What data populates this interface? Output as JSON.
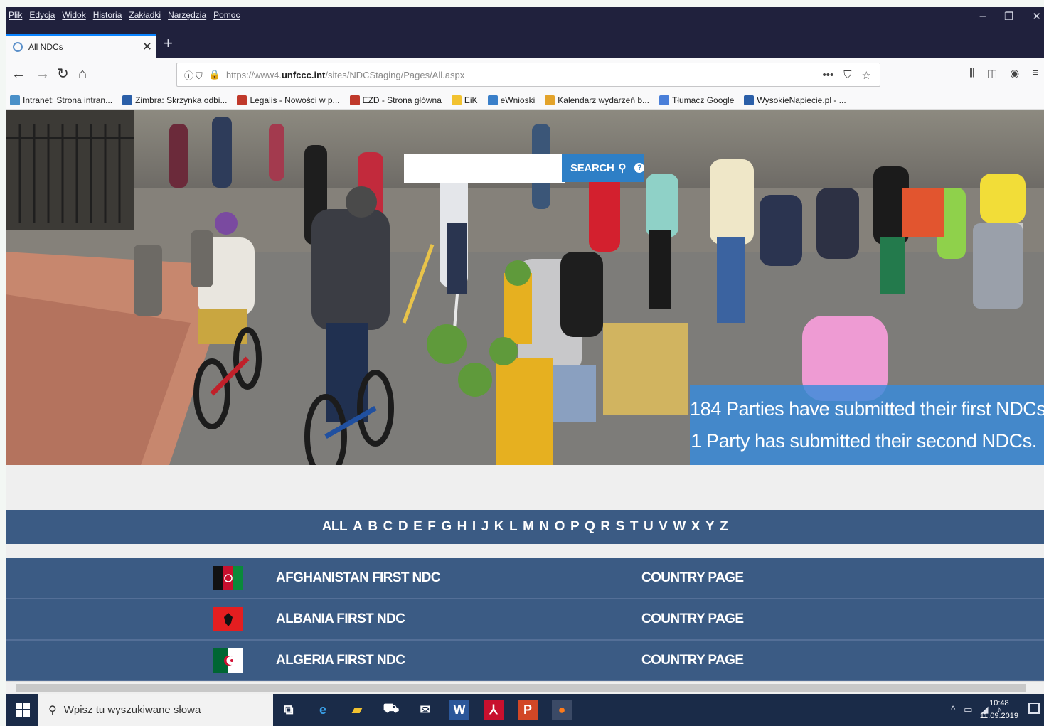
{
  "browser": {
    "menu": [
      "Plik",
      "Edycja",
      "Widok",
      "Historia",
      "Zakładki",
      "Narzędzia",
      "Pomoc"
    ],
    "tab_title": "All NDCs",
    "url_prefix": "https://www4.",
    "url_domain": "unfccc.int",
    "url_path": "/sites/NDCStaging/Pages/All.aspx",
    "bookmarks": [
      {
        "label": "Intranet: Strona intran...",
        "color": "#4a90c8"
      },
      {
        "label": "Zimbra: Skrzynka odbi...",
        "color": "#2b5fa8"
      },
      {
        "label": "Legalis - Nowości w p...",
        "color": "#c0392b"
      },
      {
        "label": "EZD - Strona główna",
        "color": "#c0392b"
      },
      {
        "label": "EiK",
        "color": "#f2c230"
      },
      {
        "label": "eWnioski",
        "color": "#3a7fc9"
      },
      {
        "label": "Kalendarz wydarzeń b...",
        "color": "#e3a32a"
      },
      {
        "label": "Tłumacz Google",
        "color": "#4a7fd9"
      },
      {
        "label": "WysokieNapiecie.pl - ...",
        "color": "#2b5fa8"
      }
    ]
  },
  "hero": {
    "search_label": "SEARCH",
    "stats_line1": "184 Parties have submitted their first NDCs.",
    "stats_line2": "1 Party has submitted their second NDCs."
  },
  "alphabet": [
    "ALL",
    "A",
    "B",
    "C",
    "D",
    "E",
    "F",
    "G",
    "H",
    "I",
    "J",
    "K",
    "L",
    "M",
    "N",
    "O",
    "P",
    "Q",
    "R",
    "S",
    "T",
    "U",
    "V",
    "W",
    "X",
    "Y",
    "Z"
  ],
  "countries": [
    {
      "name": "AFGHANISTAN  FIRST NDC",
      "link": "COUNTRY PAGE",
      "flag": "afghanistan"
    },
    {
      "name": "ALBANIA  FIRST NDC",
      "link": "COUNTRY PAGE",
      "flag": "albania"
    },
    {
      "name": "ALGERIA  FIRST NDC",
      "link": "COUNTRY PAGE",
      "flag": "algeria"
    }
  ],
  "taskbar": {
    "search_placeholder": "Wpisz tu wyszukiwane słowa",
    "time": "10:48",
    "date": "11.09.2019"
  }
}
